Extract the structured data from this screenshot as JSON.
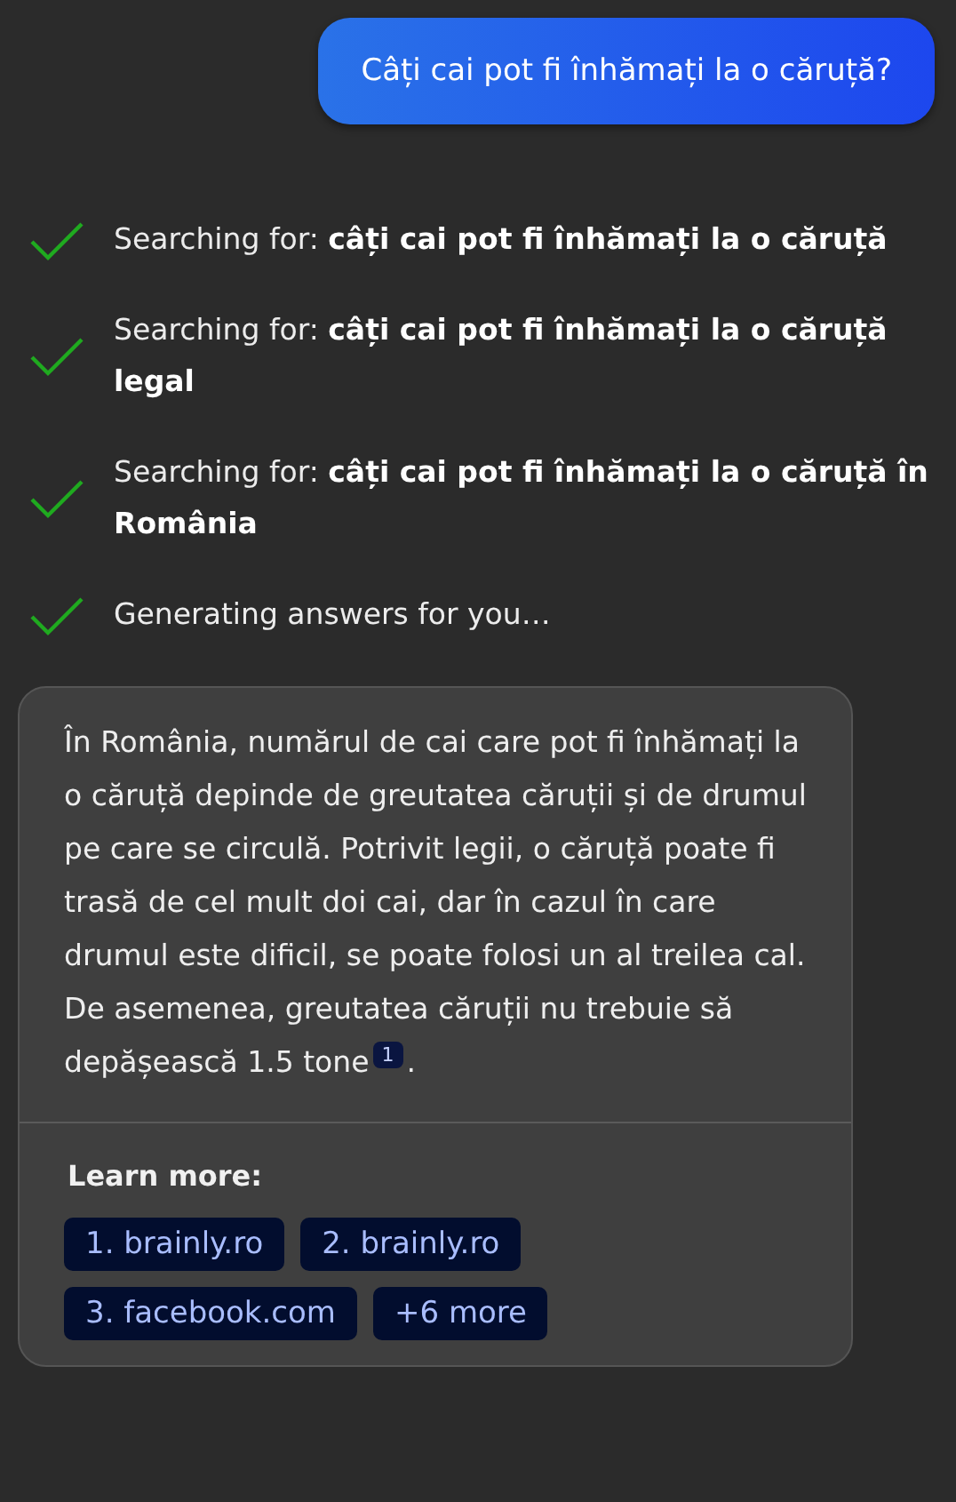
{
  "user_message": "Câți cai pot fi înhămați la o căruță?",
  "steps": [
    {
      "text": "Searching for: **câți cai pot fi înhămați la o căruță**",
      "done": true
    },
    {
      "text": "Searching for: **câți cai pot fi înhămați la o căruță legal**",
      "done": true
    },
    {
      "text": "Searching for: **câți cai pot fi înhămați la o căruță în România**",
      "done": true
    },
    {
      "text": "Generating answers for you…",
      "done": true
    }
  ],
  "answer": {
    "text": "În România, numărul de cai care pot fi înhămați la o căruță depinde de greutatea căruții și de drumul pe care se circulă. Potrivit legii, o căruță poate fi trasă de cel mult doi cai, dar în cazul în care drumul este dificil, se poate folosi un al treilea cal. De asemenea, greutatea căruții nu trebuie să depășească 1.5 tone",
    "citation": "1",
    "end": "."
  },
  "learn_more": {
    "title": "Learn more:",
    "links": [
      "1. brainly.ro",
      "2. brainly.ro",
      "3. facebook.com",
      "+6 more"
    ]
  }
}
